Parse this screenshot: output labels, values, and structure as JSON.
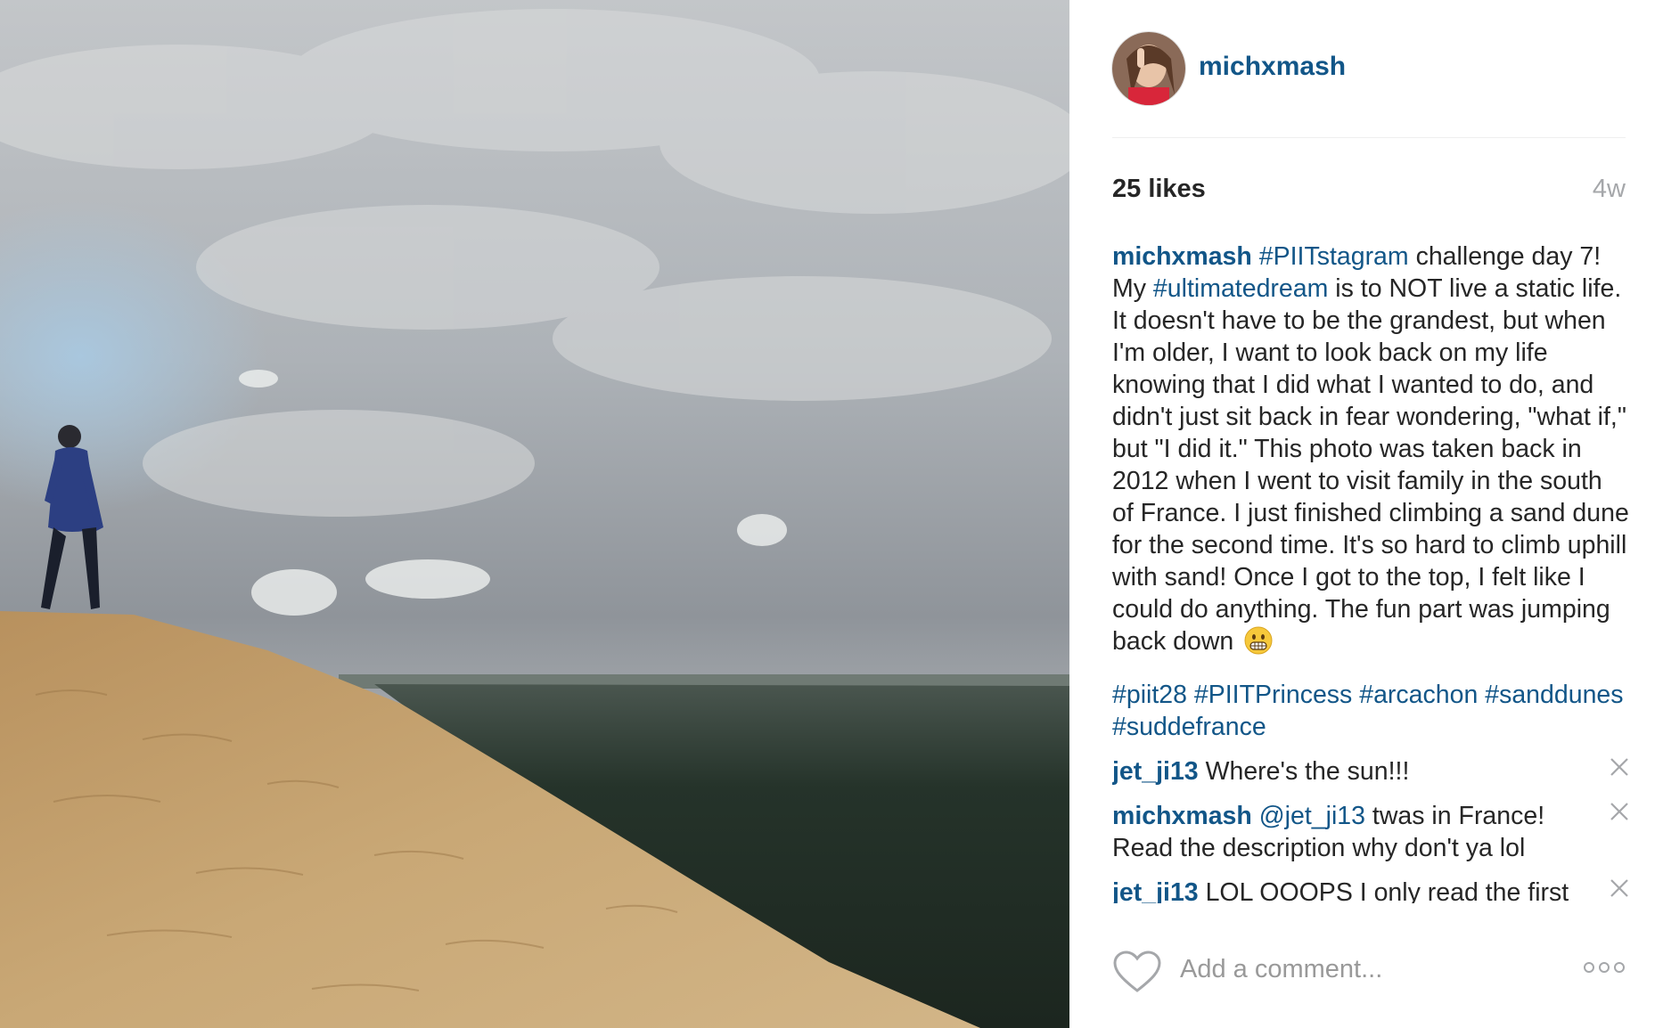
{
  "post": {
    "image_description_icon": "photo",
    "author": {
      "username": "michxmash",
      "avatar_icon": "profile-avatar"
    },
    "likes": "25 likes",
    "time_ago": "4w",
    "caption": {
      "username": "michxmash",
      "tag1": "#PIITstagram",
      "text1": " challenge day 7! My ",
      "tag2": "#ultimatedream",
      "text2": " is to NOT live a static life. It doesn't have to be the grandest, but when I'm older, I want to look back on my life knowing that I did what I wanted to do, and didn't just sit back in fear wondering, \"what if,\" but \"I did it.\" This photo was taken back in 2012 when I went to visit family in the south of France. I just finished climbing a sand dune for the second time. It's so hard to climb uphill with sand! Once I got to the top, I felt like I could do anything. The fun part was jumping back down",
      "emoji_icon": "grimacing-face",
      "hashtags": [
        "#piit28",
        "#PIITPrincess",
        "#arcachon",
        "#sanddunes",
        "#suddefrance"
      ]
    },
    "comments": [
      {
        "username": "jet_ji13",
        "mention": "",
        "text": " Where's the sun!!!"
      },
      {
        "username": "michxmash",
        "mention": " @jet_ji13",
        "text": " twas in France! Read the description why don't ya lol"
      },
      {
        "username": "jet_ji13",
        "mention": "",
        "text": " LOL OOOPS I only read the first"
      }
    ],
    "remove_icon": "close-icon"
  },
  "comment_bar": {
    "like_icon": "heart-icon",
    "placeholder": "Add a comment...",
    "more_icon": "more-options-icon"
  },
  "colors": {
    "link": "#125688",
    "text": "#262626",
    "muted": "#a5a7aa",
    "divider": "#efefef"
  }
}
